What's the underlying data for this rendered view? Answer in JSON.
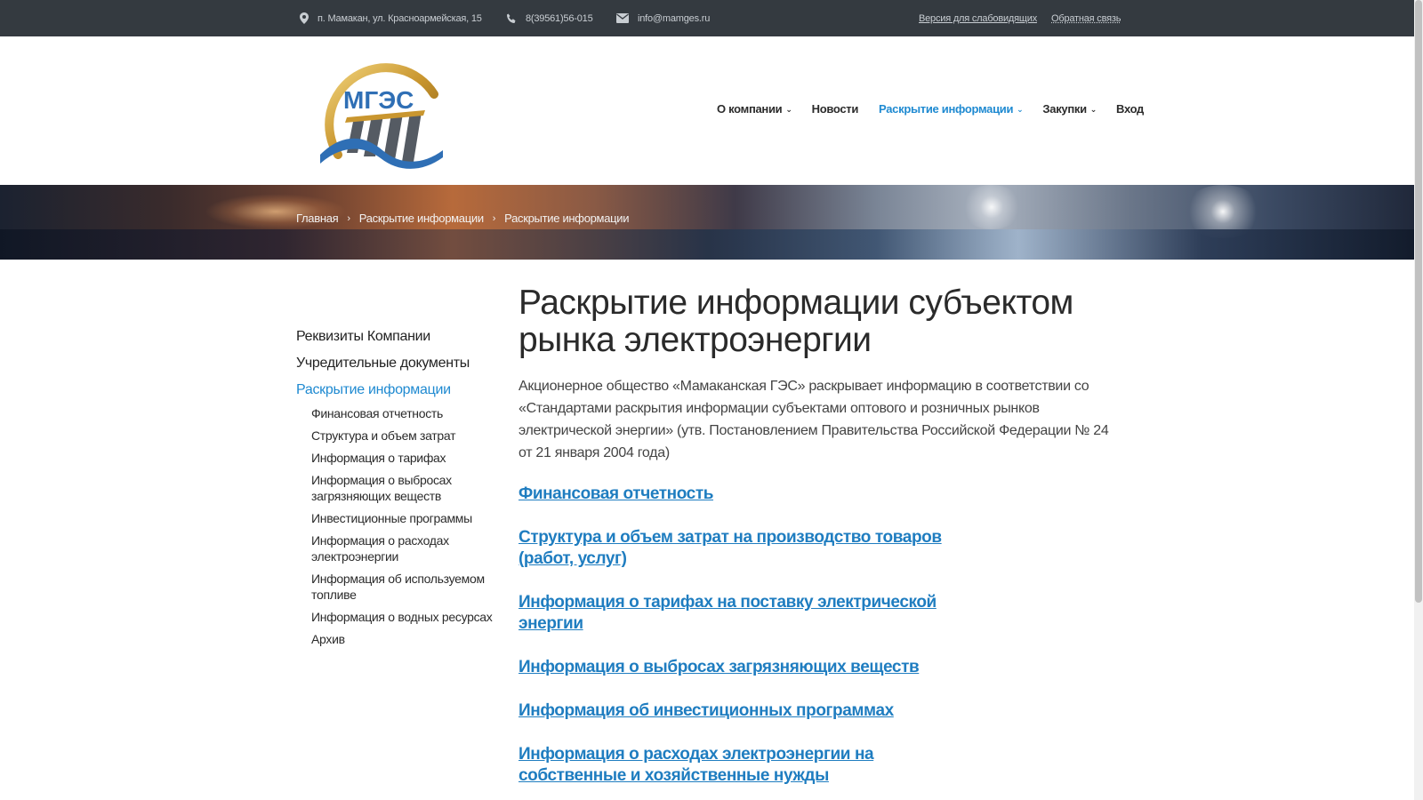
{
  "topbar": {
    "address": "п. Мамакан, ул. Красноармейская, 15",
    "phone": "8(39561)56-015",
    "email": "info@mamges.ru",
    "visually_impaired": "Версия для слабовидящих",
    "feedback": "Обратная связь"
  },
  "logo": {
    "text": "МГЭС"
  },
  "nav": {
    "items": [
      {
        "label": "О компании",
        "dropdown": true
      },
      {
        "label": "Новости",
        "dropdown": false
      },
      {
        "label": "Раскрытие информации",
        "dropdown": true
      },
      {
        "label": "Закупки",
        "dropdown": true
      },
      {
        "label": "Вход",
        "dropdown": false
      }
    ]
  },
  "breadcrumb": {
    "items": [
      "Главная",
      "Раскрытие информации",
      "Раскрытие информации"
    ]
  },
  "sidebar": {
    "top": [
      "Реквизиты Компании",
      "Учредительные документы",
      "Раскрытие информации"
    ],
    "sub": [
      "Финансовая отчетность",
      "Структура и объем затрат",
      "Информация о тарифах",
      "Информация о выбросах загрязняющих веществ",
      "Инвестиционные программы",
      "Информация о расходах электроэнергии",
      "Информация об используемом топливе",
      "Информация о водных ресурсах",
      "Архив"
    ]
  },
  "main": {
    "title": "Раскрытие информации субъектом рынка электроэнергии",
    "intro": "Акционерное общество «Мамаканская ГЭС» раскрывает информацию в соответствии со «Стандартами раскрытия информации субъектами оптового и розничных рынков электрической энергии» (утв. Постановлением Правительства Российской Федерации № 24 от 21 января 2004 года)",
    "links": [
      "Финансовая отчетность",
      "Структура и объем затрат на производство товаров (работ, услуг)",
      "Информация о тарифах на поставку электрической энергии",
      "Информация о выбросах загрязняющих веществ",
      "Информация об инвестиционных программах",
      "Информация о расходах электроэнергии на собственные и хозяйственные нужды"
    ]
  },
  "colors": {
    "accent": "#1f8ad1",
    "link": "#1f7dc0",
    "topbar": "#343a40"
  }
}
